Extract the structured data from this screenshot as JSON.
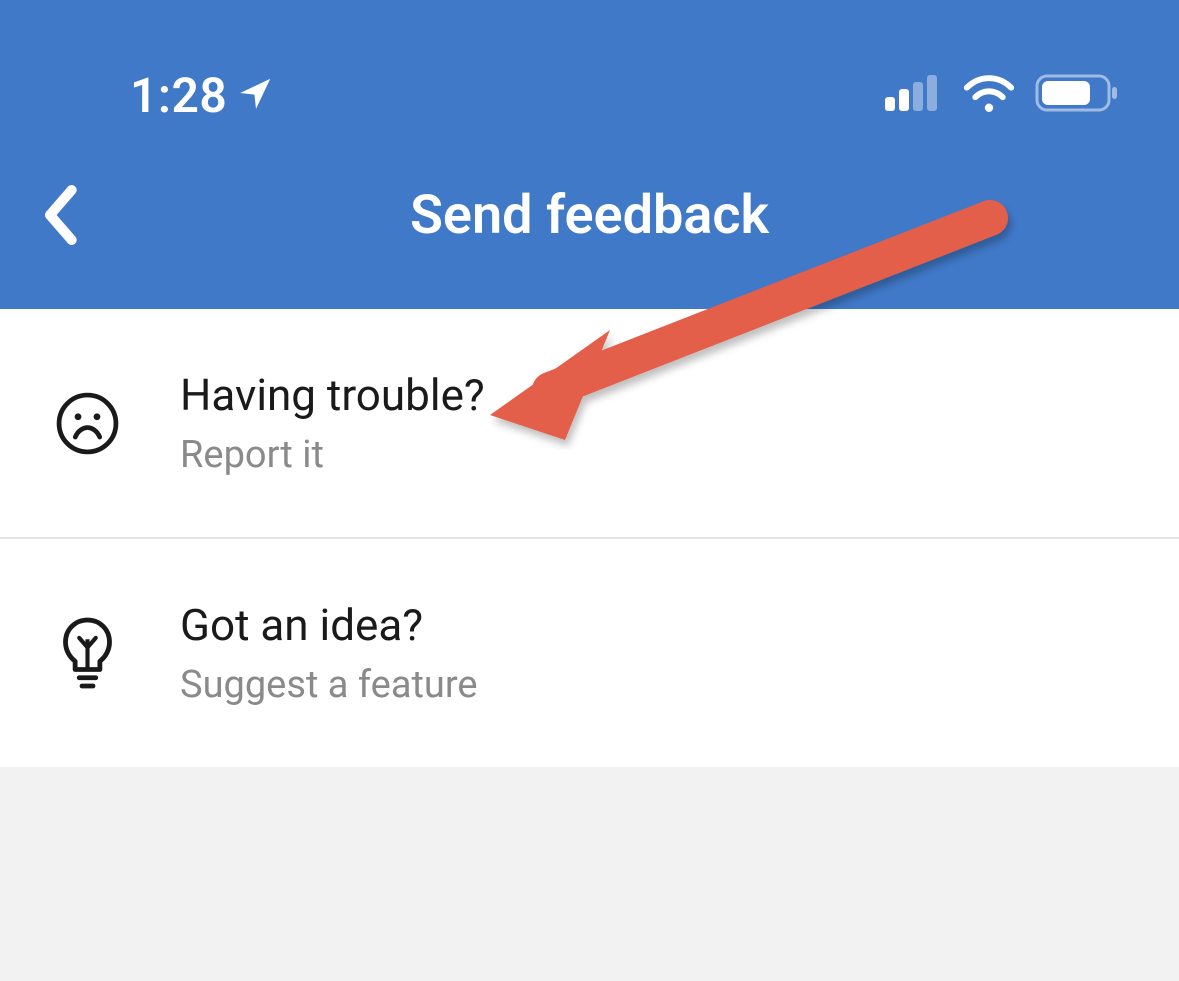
{
  "statusBar": {
    "time": "1:28"
  },
  "header": {
    "title": "Send feedback"
  },
  "items": [
    {
      "title": "Having trouble?",
      "subtitle": "Report it"
    },
    {
      "title": "Got an idea?",
      "subtitle": "Suggest a feature"
    }
  ]
}
